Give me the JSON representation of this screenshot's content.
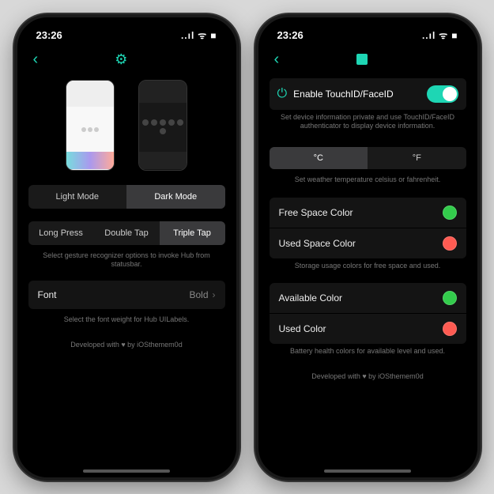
{
  "statusbar": {
    "time": "23:26",
    "signal": "..ıl",
    "wifi": "ᯤ",
    "battery": "■"
  },
  "left": {
    "modes": [
      "Light Mode",
      "Dark Mode"
    ],
    "gestures": [
      "Long Press",
      "Double Tap",
      "Triple Tap"
    ],
    "gesture_hint": "Select gesture recognizer options to invoke Hub from statusbar.",
    "font_label": "Font",
    "font_value": "Bold",
    "font_hint": "Select the font weight for Hub UILabels.",
    "footer": "Developed with ♥ by iOSthemem0d"
  },
  "right": {
    "enable_label": "Enable TouchID/FaceID",
    "enable_hint": "Set device information private and use TouchID/FaceID authenticator to display device information.",
    "temp": [
      "°C",
      "°F"
    ],
    "temp_hint": "Set weather temperature celsius or fahrenheit.",
    "storage": [
      {
        "label": "Free Space Color",
        "color": "sw-green"
      },
      {
        "label": "Used Space Color",
        "color": "sw-red"
      }
    ],
    "storage_hint": "Storage usage colors for free space and used.",
    "battery_colors": [
      {
        "label": "Available Color",
        "color": "sw-green"
      },
      {
        "label": "Used Color",
        "color": "sw-red"
      }
    ],
    "battery_hint": "Battery health colors for available level and used.",
    "footer": "Developed with ♥ by iOSthemem0d"
  }
}
